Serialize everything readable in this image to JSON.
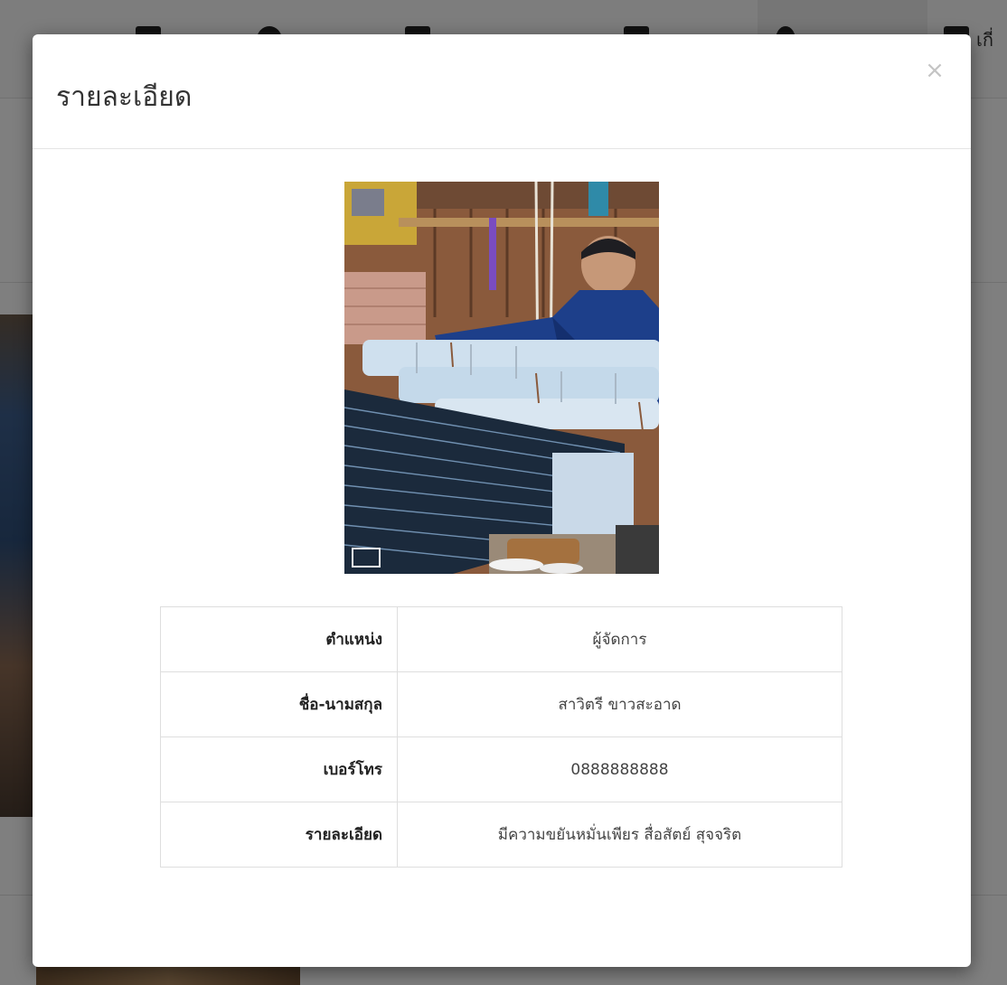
{
  "modal": {
    "title": "รายละเอียด",
    "close_symbol": "×"
  },
  "photo": {
    "subject": "weaving-loom-photo",
    "logo_text": "ไอไ"
  },
  "details": [
    {
      "label": "ตำแหน่ง",
      "value": "ผู้จัดการ"
    },
    {
      "label": "ชื่อ-นามสกุล",
      "value": "สาวิตรี ขาวสะอาด"
    },
    {
      "label": "เบอร์โทร",
      "value": "0888888888"
    },
    {
      "label": "รายละเอียด",
      "value": "มีความขยันหมั่นเพียร สื่อสัตย์ สุจจริต"
    }
  ],
  "background": {
    "nav_partial_text": "เกี่"
  },
  "colors": {
    "backdrop": "#000000",
    "modal_bg": "#ffffff",
    "border": "#dedede",
    "text": "#333333"
  }
}
